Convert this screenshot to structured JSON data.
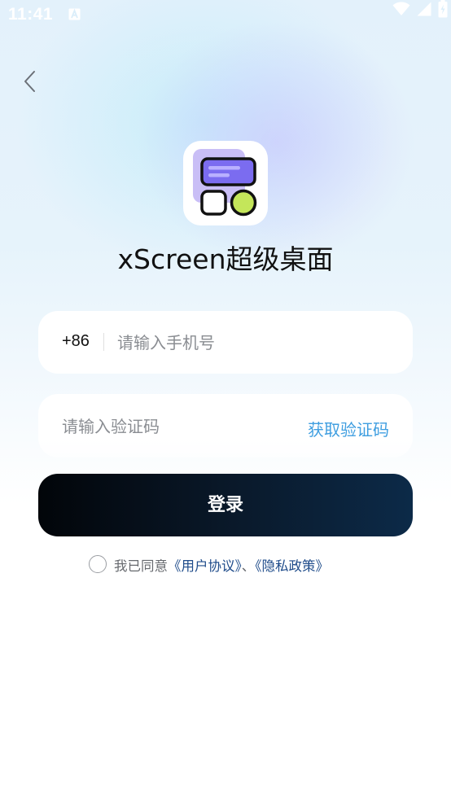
{
  "status_bar": {
    "time": "11:41"
  },
  "app": {
    "title": "xScreen超级桌面"
  },
  "form": {
    "country_code": "+86",
    "phone_placeholder": "请输入手机号",
    "code_placeholder": "请输入验证码",
    "get_code_label": "获取验证码",
    "login_label": "登录"
  },
  "agreement": {
    "prefix": "我已同意",
    "user_agreement": "《用户协议》",
    "separator": "、",
    "privacy_policy": "《隐私政策》",
    "checked": false
  },
  "colors": {
    "accent_link": "#3f9ee0",
    "agreement_link": "#1e4b8a",
    "login_button_start": "#020509",
    "login_button_end": "#0c2a48",
    "logo_purple": "#7b6cf0",
    "logo_green": "#c4e65a"
  },
  "icons": {
    "back": "chevron-left-icon",
    "wifi": "wifi-icon",
    "signal": "signal-icon",
    "battery": "battery-icon",
    "status_app": "a-letter-icon"
  }
}
